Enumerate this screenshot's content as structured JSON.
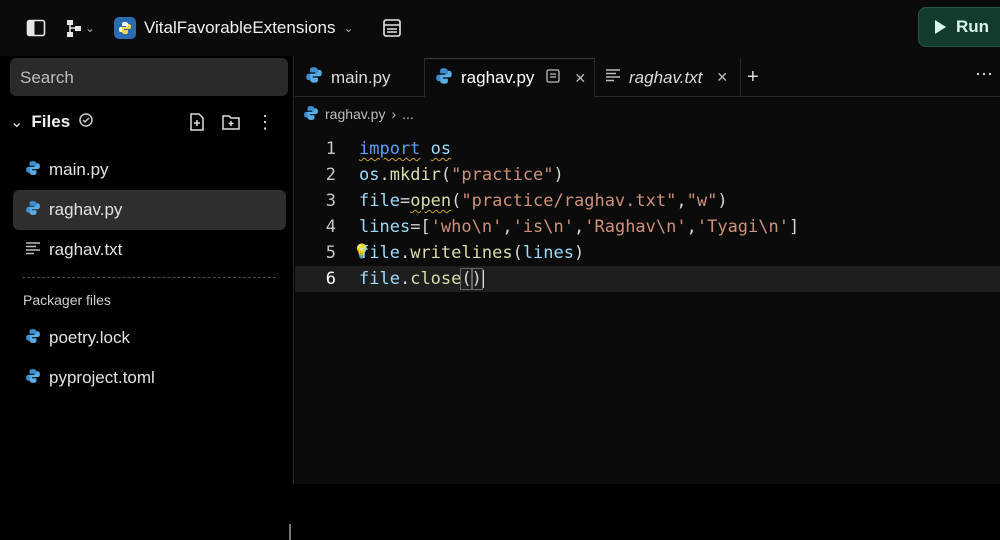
{
  "topbar": {
    "project_name": "VitalFavorableExtensions",
    "run_label": "Run"
  },
  "sidebar": {
    "search_placeholder": "Search",
    "files_title": "Files",
    "files": [
      {
        "name": "main.py",
        "icon": "python-icon",
        "active": false
      },
      {
        "name": "raghav.py",
        "icon": "python-icon",
        "active": true
      },
      {
        "name": "raghav.txt",
        "icon": "text-file-icon",
        "active": false
      }
    ],
    "packager_label": "Packager files",
    "packager_files": [
      {
        "name": "poetry.lock",
        "icon": "python-icon"
      },
      {
        "name": "pyproject.toml",
        "icon": "python-icon"
      }
    ]
  },
  "editor": {
    "tabs": [
      {
        "label": "main.py",
        "active": false
      },
      {
        "label": "raghav.py",
        "active": true
      },
      {
        "label": "raghav.txt",
        "active": false
      }
    ],
    "breadcrumb": {
      "file": "raghav.py",
      "sep": "›",
      "rest": "..."
    },
    "line_numbers": [
      "1",
      "2",
      "3",
      "4",
      "5",
      "6"
    ],
    "code_lines": [
      "import os",
      "os.mkdir(\"practice\")",
      "file=open(\"practice/raghav.txt\",\"w\")",
      "lines=['who\\n','is\\n','Raghav\\n','Tyagi\\n']",
      "file.writelines(lines)",
      "file.close()"
    ],
    "current_line": 6
  },
  "colors": {
    "run_bg": "#123b2e",
    "keyword": "#5d9ef5",
    "string": "#ce9178",
    "function": "#dcdcaa",
    "identifier": "#9cdcfe"
  }
}
